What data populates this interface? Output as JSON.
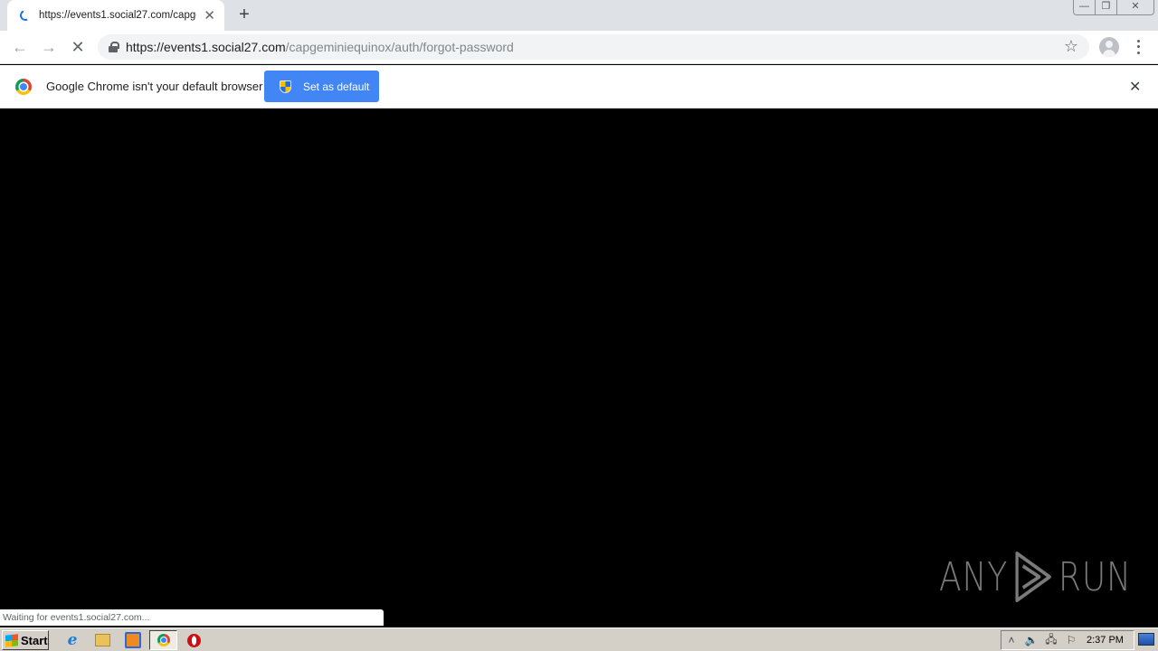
{
  "browser": {
    "tab": {
      "title": "https://events1.social27.com/capgeminiequinox/auth/forgot-password",
      "loading": true
    },
    "new_tab_label": "+",
    "window_controls": {
      "minimize": "—",
      "restore": "❐",
      "close": "✕"
    },
    "nav": {
      "back": "←",
      "forward": "→",
      "stop": "✕"
    },
    "address": {
      "host": "https://events1.social27.com",
      "path": "/capgeminiequinox/auth/forgot-password"
    },
    "bookmark_star": "☆",
    "infobar": {
      "message": "Google Chrome isn't your default browser",
      "button_label": "Set as default",
      "close": "✕"
    },
    "status_text": "Waiting for events1.social27.com..."
  },
  "watermark": {
    "left": "ANY",
    "right": "RUN"
  },
  "taskbar": {
    "start_label": "Start",
    "quick_launch": [
      "Internet Explorer",
      "Windows Explorer",
      "Windows Media Player",
      "Google Chrome",
      "Opera"
    ],
    "tray": {
      "expand": "˄",
      "volume": "🔈",
      "network": "🖧",
      "flag": "⚐",
      "clock": "2:37 PM"
    }
  }
}
